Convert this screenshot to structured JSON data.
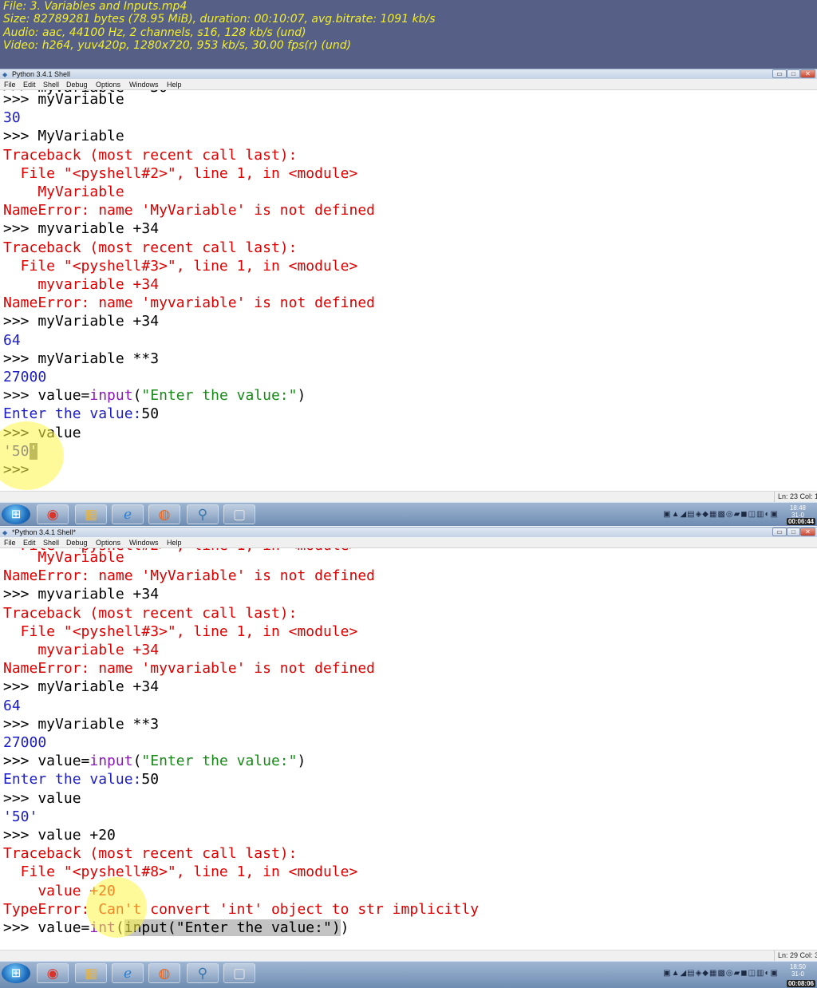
{
  "info_overlay": {
    "file_line": "File: 3. Variables and Inputs.mp4",
    "size_line": "Size: 82789281 bytes (78.95 MiB), duration: 00:10:07, avg.bitrate: 1091 kb/s",
    "audio_line": "Audio: aac, 44100 Hz, 2 channels, s16, 128 kb/s (und)",
    "video_line": "Video: h264, yuv420p, 1280x720, 953 kb/s, 30.00 fps(r) (und)"
  },
  "menu_items": [
    "File",
    "Edit",
    "Shell",
    "Debug",
    "Options",
    "Windows",
    "Help"
  ],
  "window_controls": {
    "minimize": "▭",
    "maximize": "□",
    "close": "✕"
  },
  "taskbar": {
    "apps": [
      {
        "name": "start",
        "glyph": "⊞"
      },
      {
        "name": "chrome",
        "glyph": "◉",
        "color": "#d9342a"
      },
      {
        "name": "explorer",
        "glyph": "▦",
        "color": "#e3b44a"
      },
      {
        "name": "ie",
        "glyph": "ℯ",
        "color": "#2a7fd4"
      },
      {
        "name": "firefox",
        "glyph": "◍",
        "color": "#e4661f"
      },
      {
        "name": "python",
        "glyph": "⚲",
        "color": "#3776ab"
      },
      {
        "name": "window",
        "glyph": "▢",
        "color": "#e8e8e8"
      }
    ],
    "tray_icons": "▣▲◢▤◈◆▦▩◎▰◼◫▥◐▣"
  },
  "shot1": {
    "window_title": "Python 3.4.1 Shell",
    "status_position": "Ln: 23  Col: 1",
    "clock_time": "18:48",
    "clock_date": "31-0",
    "timestamp": "00:06:44",
    "lines": [
      [
        {
          "t": ">>> myVariable",
          "c": "p"
        }
      ],
      [
        {
          "t": "30",
          "c": "o"
        }
      ],
      [
        {
          "t": ">>> MyVariable",
          "c": "p"
        }
      ],
      [
        {
          "t": "Traceback (most recent call last):",
          "c": "e"
        }
      ],
      [
        {
          "t": "  File \"<pyshell#2>\", line 1, in <module>",
          "c": "e"
        }
      ],
      [
        {
          "t": "    MyVariable",
          "c": "e"
        }
      ],
      [
        {
          "t": "NameError: name 'MyVariable' is not defined",
          "c": "e"
        }
      ],
      [
        {
          "t": ">>> myvariable +34",
          "c": "p"
        }
      ],
      [
        {
          "t": "Traceback (most recent call last):",
          "c": "e"
        }
      ],
      [
        {
          "t": "  File \"<pyshell#3>\", line 1, in <module>",
          "c": "e"
        }
      ],
      [
        {
          "t": "    myvariable +34",
          "c": "e"
        }
      ],
      [
        {
          "t": "NameError: name 'myvariable' is not defined",
          "c": "e"
        }
      ],
      [
        {
          "t": ">>> myVariable +34",
          "c": "p"
        }
      ],
      [
        {
          "t": "64",
          "c": "o"
        }
      ],
      [
        {
          "t": ">>> myVariable **3",
          "c": "p"
        }
      ],
      [
        {
          "t": "27000",
          "c": "o"
        }
      ],
      [
        {
          "t": ">>> value=",
          "c": "p"
        },
        {
          "t": "input",
          "c": "b"
        },
        {
          "t": "(",
          "c": "p"
        },
        {
          "t": "\"Enter the value:\"",
          "c": "s"
        },
        {
          "t": ")",
          "c": "p"
        }
      ],
      [
        {
          "t": "Enter the value:",
          "c": "o"
        },
        {
          "t": "50",
          "c": "p"
        }
      ],
      [
        {
          "t": ">>> value",
          "c": "p"
        }
      ],
      [
        {
          "t": "'50",
          "c": "o"
        },
        {
          "t": "'",
          "c": "cur"
        }
      ],
      [
        {
          "t": ">>> ",
          "c": "p"
        }
      ]
    ]
  },
  "shot2": {
    "window_title": "*Python 3.4.1 Shell*",
    "status_position": "Ln: 29  Col: 39",
    "clock_time": "18:50",
    "clock_date": "31-0",
    "timestamp": "00:08:06",
    "lines": [
      [
        {
          "t": "    MyVariable",
          "c": "e"
        }
      ],
      [
        {
          "t": "NameError: name 'MyVariable' is not defined",
          "c": "e"
        }
      ],
      [
        {
          "t": ">>> myvariable +34",
          "c": "p"
        }
      ],
      [
        {
          "t": "Traceback (most recent call last):",
          "c": "e"
        }
      ],
      [
        {
          "t": "  File \"<pyshell#3>\", line 1, in <module>",
          "c": "e"
        }
      ],
      [
        {
          "t": "    myvariable +34",
          "c": "e"
        }
      ],
      [
        {
          "t": "NameError: name 'myvariable' is not defined",
          "c": "e"
        }
      ],
      [
        {
          "t": ">>> myVariable +34",
          "c": "p"
        }
      ],
      [
        {
          "t": "64",
          "c": "o"
        }
      ],
      [
        {
          "t": ">>> myVariable **3",
          "c": "p"
        }
      ],
      [
        {
          "t": "27000",
          "c": "o"
        }
      ],
      [
        {
          "t": ">>> value=",
          "c": "p"
        },
        {
          "t": "input",
          "c": "b"
        },
        {
          "t": "(",
          "c": "p"
        },
        {
          "t": "\"Enter the value:\"",
          "c": "s"
        },
        {
          "t": ")",
          "c": "p"
        }
      ],
      [
        {
          "t": "Enter the value:",
          "c": "o"
        },
        {
          "t": "50",
          "c": "p"
        }
      ],
      [
        {
          "t": ">>> value",
          "c": "p"
        }
      ],
      [
        {
          "t": "'50'",
          "c": "o"
        }
      ],
      [
        {
          "t": ">>> value +20",
          "c": "p"
        }
      ],
      [
        {
          "t": "Traceback (most recent call last):",
          "c": "e"
        }
      ],
      [
        {
          "t": "  File \"<pyshell#8>\", line 1, in <module>",
          "c": "e"
        }
      ],
      [
        {
          "t": "    value +20",
          "c": "e"
        }
      ],
      [
        {
          "t": "TypeError: Can't convert 'int' object to str implicitly",
          "c": "e"
        }
      ],
      [
        {
          "t": ">>> value=",
          "c": "p"
        },
        {
          "t": "int",
          "c": "b"
        },
        {
          "t": "(",
          "c": "p"
        },
        {
          "t": "input(\"Enter the value:\")",
          "c": "sel"
        },
        {
          "t": ")",
          "c": "p"
        }
      ]
    ]
  }
}
